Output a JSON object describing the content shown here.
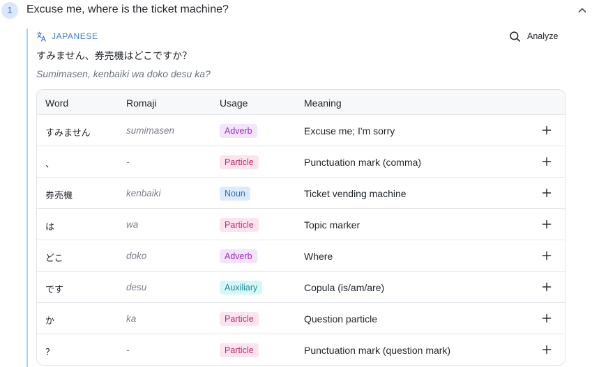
{
  "item": {
    "number": "1",
    "sentence": "Excuse me, where is the ticket machine?"
  },
  "translation": {
    "language_label": "JAPANESE",
    "analyze_label": "Analyze",
    "text": "すみません、券売機はどこですか？",
    "romanized": "Sumimasen, kenbaiki wa doko desu ka?"
  },
  "table": {
    "headers": {
      "word": "Word",
      "romaji": "Romaji",
      "usage": "Usage",
      "meaning": "Meaning"
    },
    "rows": [
      {
        "word": "すみません",
        "romaji": "sumimasen",
        "usage": "Adverb",
        "usage_class": "adverb",
        "meaning": "Excuse me; I'm sorry"
      },
      {
        "word": "、",
        "romaji": "-",
        "usage": "Particle",
        "usage_class": "particle",
        "meaning": "Punctuation mark (comma)"
      },
      {
        "word": "券売機",
        "romaji": "kenbaiki",
        "usage": "Noun",
        "usage_class": "noun",
        "meaning": "Ticket vending machine"
      },
      {
        "word": "は",
        "romaji": "wa",
        "usage": "Particle",
        "usage_class": "particle",
        "meaning": "Topic marker"
      },
      {
        "word": "どこ",
        "romaji": "doko",
        "usage": "Adverb",
        "usage_class": "adverb",
        "meaning": "Where"
      },
      {
        "word": "です",
        "romaji": "desu",
        "usage": "Auxiliary",
        "usage_class": "auxiliary",
        "meaning": "Copula (is/am/are)"
      },
      {
        "word": "か",
        "romaji": "ka",
        "usage": "Particle",
        "usage_class": "particle",
        "meaning": "Question particle"
      },
      {
        "word": "？",
        "romaji": "-",
        "usage": "Particle",
        "usage_class": "particle",
        "meaning": "Punctuation mark (question mark)"
      }
    ]
  },
  "colors": {
    "accent": "#3b7ed6",
    "badge_bg": "#dbe7fb",
    "rail": "#a9cdf2"
  },
  "icons": {
    "collapse": "chevron-up-icon",
    "language": "translate-icon",
    "analyze": "search-icon",
    "add": "plus-icon"
  }
}
